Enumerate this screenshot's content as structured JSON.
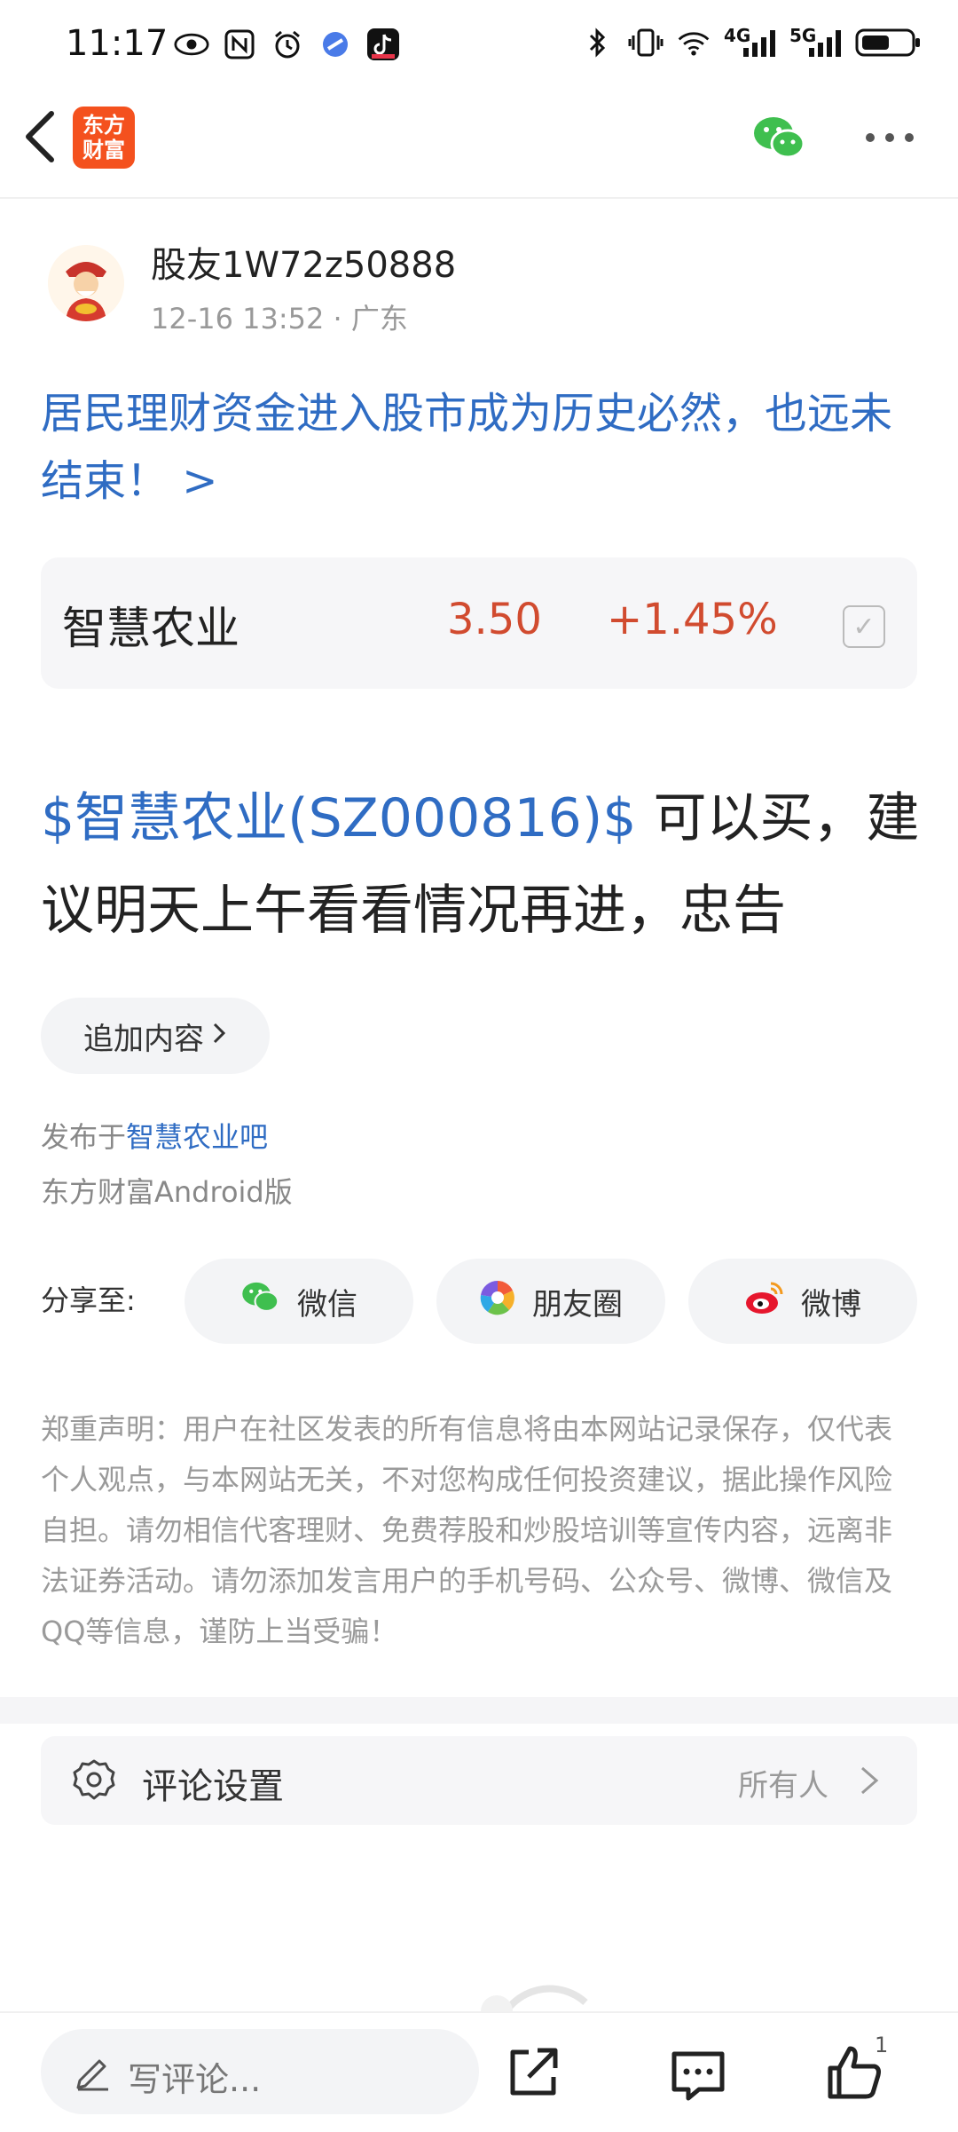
{
  "status_bar": {
    "time": "11:17",
    "network_1": "4G",
    "network_2": "5G"
  },
  "header": {
    "logo_text_line1": "东方",
    "logo_text_line2": "财富"
  },
  "post": {
    "username": "股友1W72z50888",
    "meta": "12-16 13:52 · 广东",
    "title": "居民理财资金进入股市成为历史必然，也远未结束！ >",
    "stock": {
      "name": "智慧农业",
      "price": "3.50",
      "change": "+1.45%"
    },
    "body_link": "$智慧农业(SZ000816)$",
    "body_text": " 可以买，建议明天上午看看情况再进，忠告",
    "append_label": "追加内容",
    "published_prefix": "发布于",
    "published_board": "智慧农业吧",
    "client": "东方财富Android版"
  },
  "share": {
    "label": "分享至:",
    "wechat": "微信",
    "moments": "朋友圈",
    "weibo": "微博"
  },
  "disclaimer": "郑重声明：用户在社区发表的所有信息将由本网站记录保存，仅代表个人观点，与本网站无关，不对您构成任何投资建议，据此操作风险自担。请勿相信代客理财、免费荐股和炒股培训等宣传内容，远离非法证券活动。请勿添加发言用户的手机号码、公众号、微博、微信及QQ等信息，谨防上当受骗！",
  "comment_settings": {
    "label": "评论设置",
    "value": "所有人"
  },
  "bottom_bar": {
    "placeholder": "写评论...",
    "like_count": "1"
  },
  "colors": {
    "link_blue": "#2f6cc3",
    "up_red": "#d14b2f",
    "logo_orange": "#f4511e",
    "wechat_green": "#3fbf4f"
  }
}
